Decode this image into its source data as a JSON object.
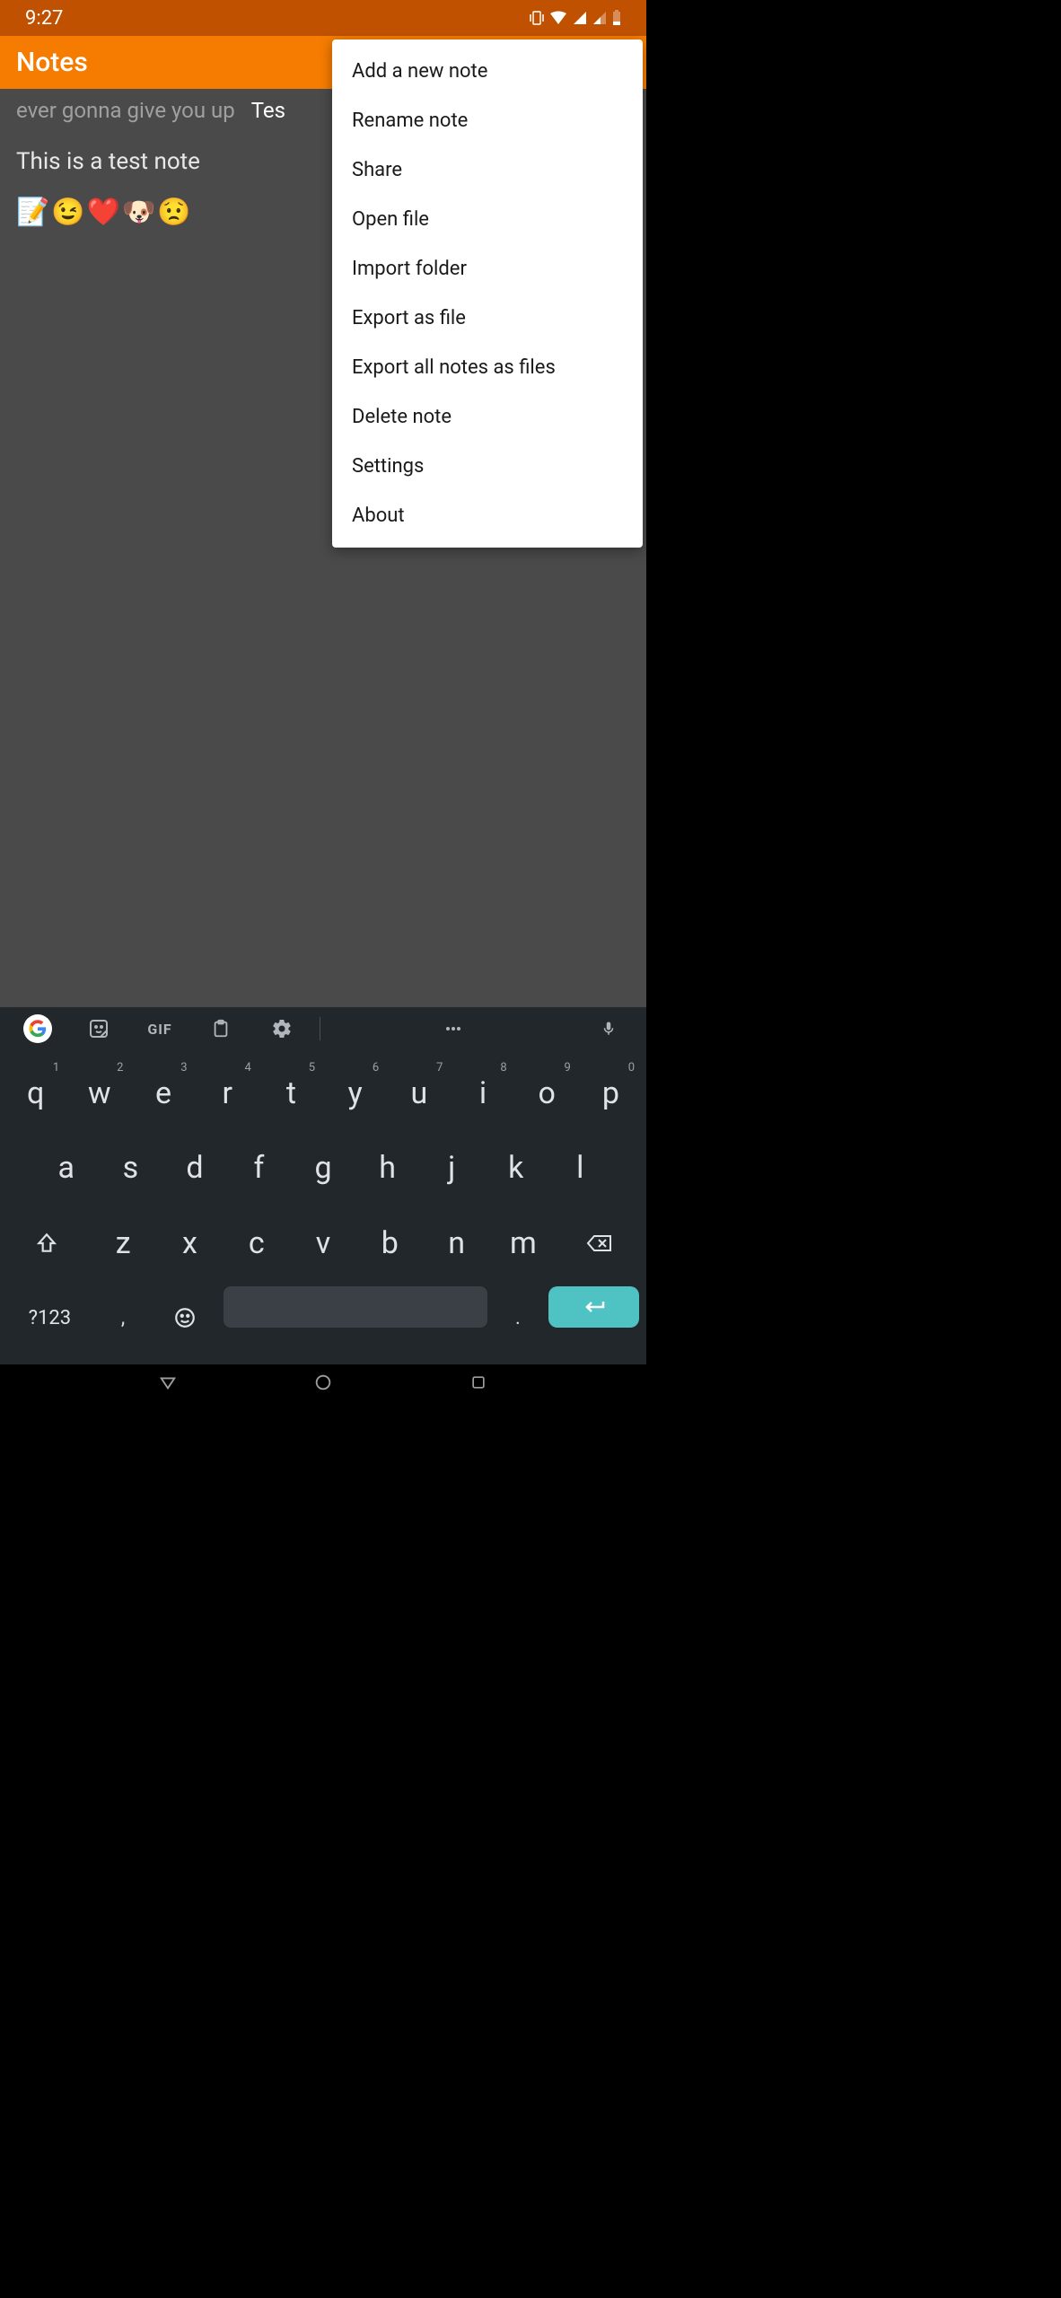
{
  "status": {
    "time": "9:27"
  },
  "app": {
    "title": "Notes"
  },
  "tabs": {
    "inactive1": "ever gonna give you up",
    "active_partial": "Tes"
  },
  "note": {
    "line1": "This is a test note",
    "emoji_line": "📝😉❤️🐶😟"
  },
  "menu": {
    "items": [
      "Add a new note",
      "Rename note",
      "Share",
      "Open file",
      "Import folder",
      "Export as file",
      "Export all notes as files",
      "Delete note",
      "Settings",
      "About"
    ]
  },
  "keyboard": {
    "gif": "GIF",
    "row1": [
      {
        "k": "q",
        "h": "1"
      },
      {
        "k": "w",
        "h": "2"
      },
      {
        "k": "e",
        "h": "3"
      },
      {
        "k": "r",
        "h": "4"
      },
      {
        "k": "t",
        "h": "5"
      },
      {
        "k": "y",
        "h": "6"
      },
      {
        "k": "u",
        "h": "7"
      },
      {
        "k": "i",
        "h": "8"
      },
      {
        "k": "o",
        "h": "9"
      },
      {
        "k": "p",
        "h": "0"
      }
    ],
    "row2": [
      "a",
      "s",
      "d",
      "f",
      "g",
      "h",
      "j",
      "k",
      "l"
    ],
    "row3": [
      "z",
      "x",
      "c",
      "v",
      "b",
      "n",
      "m"
    ],
    "sym": "?123",
    "comma": ",",
    "period": "."
  }
}
